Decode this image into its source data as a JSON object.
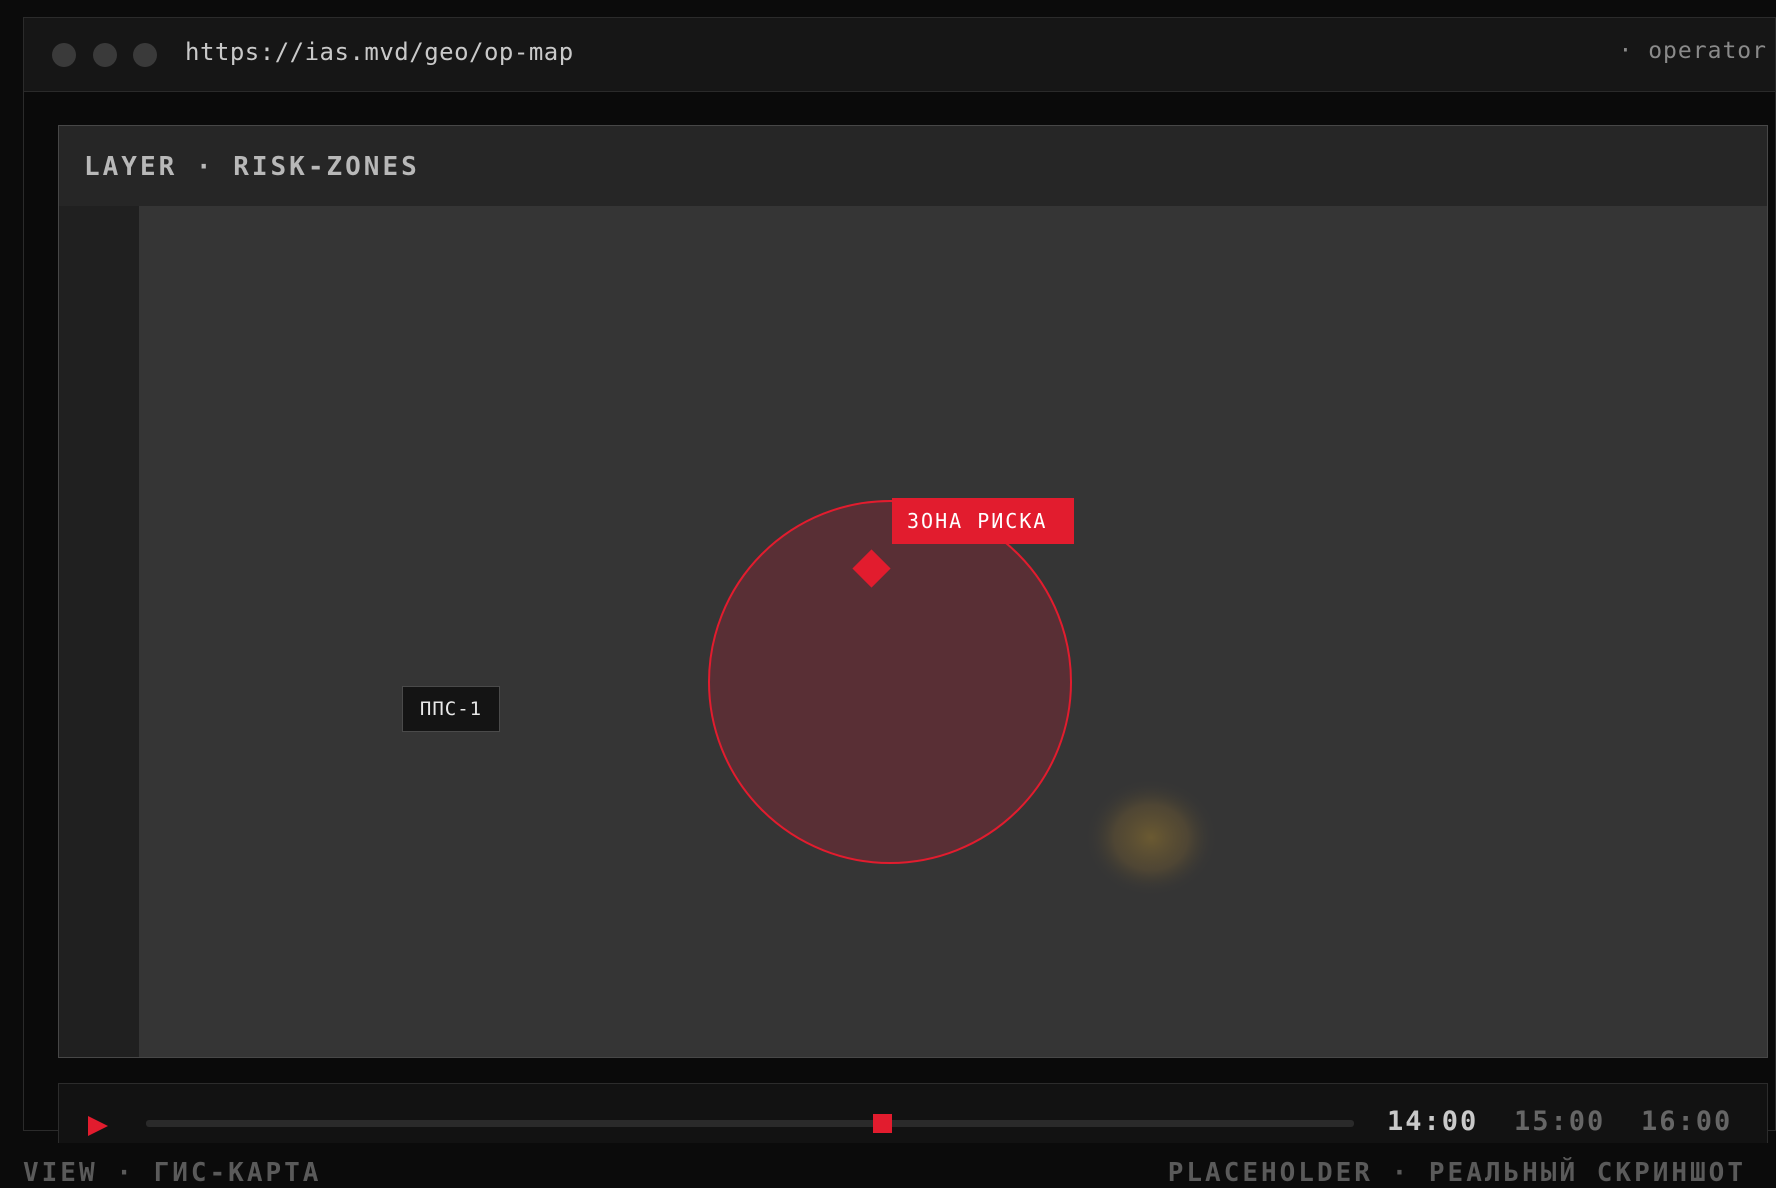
{
  "browser": {
    "url": "https://ias.mvd/geo/op-map",
    "user_label": "· operator"
  },
  "map": {
    "layer_title": "LAYER · RISK-ZONES",
    "units": [
      {
        "label": "ППС-1"
      }
    ],
    "risk_zone": {
      "label": "ЗОНА РИСКА",
      "stroke_color": "#e21c2e",
      "fill_color": "#592f35"
    },
    "hotspot_color": "#6b5a32"
  },
  "timeline": {
    "play_icon": "play-icon",
    "position": 0.61,
    "times": [
      "14:00",
      "15:00",
      "16:00"
    ],
    "active_index": 0
  },
  "footer": {
    "left": "VIEW · ГИС-КАРТА",
    "right": "PLACEHOLDER · РЕАЛЬНЫЙ СКРИНШОТ"
  },
  "colors": {
    "accent": "#e21c2e",
    "background": "#0b0b0b",
    "map_bg": "#353535"
  }
}
